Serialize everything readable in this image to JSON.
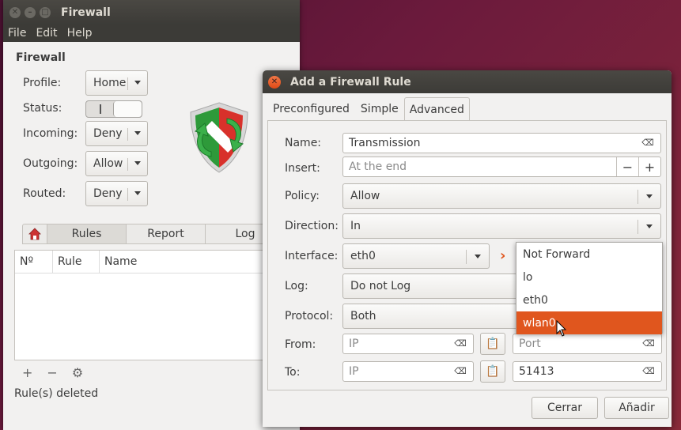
{
  "main_window": {
    "title": "Firewall",
    "menu": [
      "File",
      "Edit",
      "Help"
    ],
    "section_title": "Firewall",
    "profile_label": "Profile:",
    "profile_value": "Home",
    "status_label": "Status:",
    "incoming_label": "Incoming:",
    "incoming_value": "Deny",
    "outgoing_label": "Outgoing:",
    "outgoing_value": "Allow",
    "routed_label": "Routed:",
    "routed_value": "Deny",
    "tabs": [
      "Rules",
      "Report",
      "Log"
    ],
    "columns": [
      "Nº",
      "Rule",
      "Name"
    ],
    "status_text": "Rule(s) deleted"
  },
  "dialog": {
    "title": "Add a Firewall Rule",
    "tabs": [
      "Preconfigured",
      "Simple",
      "Advanced"
    ],
    "active_tab": "Advanced",
    "name_label": "Name:",
    "name_value": "Transmission",
    "insert_label": "Insert:",
    "insert_placeholder": "At the end",
    "policy_label": "Policy:",
    "policy_value": "Allow",
    "direction_label": "Direction:",
    "direction_value": "In",
    "interface_label": "Interface:",
    "interface_value": "eth0",
    "log_label": "Log:",
    "log_value": "Do not Log",
    "protocol_label": "Protocol:",
    "protocol_value": "Both",
    "from_label": "From:",
    "from_ip_placeholder": "IP",
    "from_port_placeholder": "Port",
    "to_label": "To:",
    "to_ip_placeholder": "IP",
    "to_port_value": "51413",
    "cancel_label": "Cerrar",
    "add_label": "Añadir"
  },
  "interface_dropdown": {
    "options": [
      "Not Forward",
      "lo",
      "eth0",
      "wlan0"
    ],
    "highlighted": "wlan0"
  },
  "colors": {
    "accent": "#e0561e",
    "titlebar": "#3c3b37",
    "window_bg": "#f2f1f0"
  }
}
